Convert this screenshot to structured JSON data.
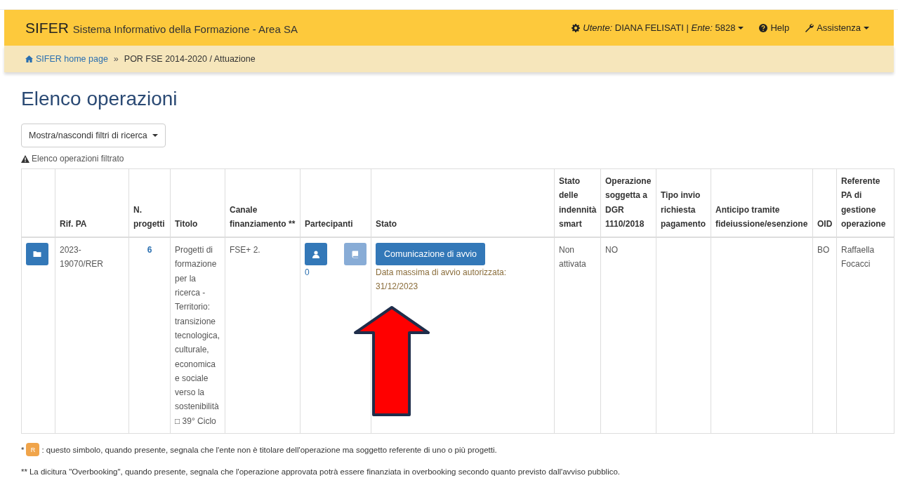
{
  "header": {
    "brand": "SIFER",
    "subtitle": "Sistema Informativo della Formazione - Area SA",
    "user_label": "Utente:",
    "user_name": "DIANA FELISATI |",
    "ente_label": "Ente:",
    "ente_value": "5828",
    "help": "Help",
    "assistenza": "Assistenza"
  },
  "breadcrumb": [
    {
      "label": "SIFER home page",
      "kind": "link"
    },
    {
      "label": "»",
      "kind": "separator"
    },
    {
      "label": "POR FSE 2014-2020 / Attuazione",
      "kind": "current"
    }
  ],
  "page_title": "Elenco operazioni",
  "filter_toggle": "Mostra/nascondi filtri di ricerca",
  "filter_notice": "Elenco operazioni filtrato",
  "table": {
    "columns": [
      "Rif. PA",
      "N. progetti",
      "Titolo",
      "Canale finanziamento **",
      "Partecipanti",
      "Stato",
      "Stato delle indennità smart",
      "Operazione soggetta a DGR 1110/2018",
      "Tipo invio richiesta pagamento",
      "Anticipo tramite fideiussione/esenzione",
      "OID",
      "Referente PA di gestione operazione"
    ],
    "rows": [
      {
        "rif_pa": "2023-19070/RER",
        "n_progetti": "6",
        "titolo": "Progetti di formazione per la ricerca - Territorio: transizione tecnologica, culturale, economica e sociale verso la sostenibilità □ 39° Ciclo",
        "canale": "FSE+ 2.",
        "participant_buttons": [
          {
            "kind": "person",
            "disabled": false
          },
          {
            "kind": "book",
            "disabled": true
          }
        ],
        "participant_count": "0",
        "stato_button": "Comunicazione di avvio",
        "stato_note": "Data massima di avvio autorizzata: 31/12/2023",
        "indennita": "Non attivata",
        "dgr": "NO",
        "oid": "BO",
        "referente": "Raffaella Focacci"
      }
    ]
  },
  "footnotes": [
    {
      "mark": "*",
      "badge": "R",
      "text": ": questo simbolo, quando presente, segnala che l'ente non è titolare dell'operazione ma soggetto referente di uno o più progetti."
    },
    {
      "mark": "**",
      "text": "La dicitura \"Overbooking\", quando presente, segnala che l'operazione approvata potrà essere finanziata in overbooking secondo quanto previsto dall'avviso pubblico."
    }
  ]
}
